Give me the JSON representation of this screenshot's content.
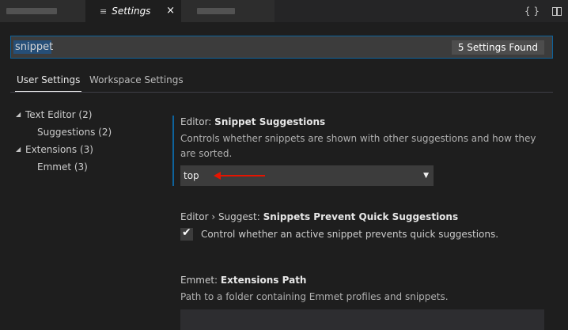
{
  "tabs": [
    {
      "label": "",
      "blurred": true
    },
    {
      "label": "Settings",
      "icon": "settings-lines-icon",
      "active": true,
      "close": "×"
    },
    {
      "label": "",
      "blurred": true
    }
  ],
  "editor_actions": {
    "json_icon": "{ }",
    "split_icon": "split-editor-icon"
  },
  "search": {
    "value": "snippet",
    "results": "5 Settings Found"
  },
  "scopes": {
    "user": "User Settings",
    "workspace": "Workspace Settings"
  },
  "toc": [
    {
      "label": "Text Editor (2)",
      "expanded": true,
      "level": 0
    },
    {
      "label": "Suggestions (2)",
      "level": 1
    },
    {
      "label": "Extensions (3)",
      "expanded": true,
      "level": 0
    },
    {
      "label": "Emmet (3)",
      "level": 1
    }
  ],
  "settings": [
    {
      "category": "Editor: ",
      "name": "Snippet Suggestions",
      "description": "Controls whether snippets are shown with other suggestions and how they are sorted.",
      "value": "top"
    },
    {
      "category": "Editor › Suggest: ",
      "name": "Snippets Prevent Quick Suggestions",
      "description": "Control whether an active snippet prevents quick suggestions.",
      "checked": true
    },
    {
      "category": "Emmet: ",
      "name": "Extensions Path",
      "description": "Path to a folder containing Emmet profiles and snippets."
    }
  ],
  "colors": {
    "accent": "#0e639c",
    "annotation": "#e51400",
    "background": "#1e1e1e"
  }
}
